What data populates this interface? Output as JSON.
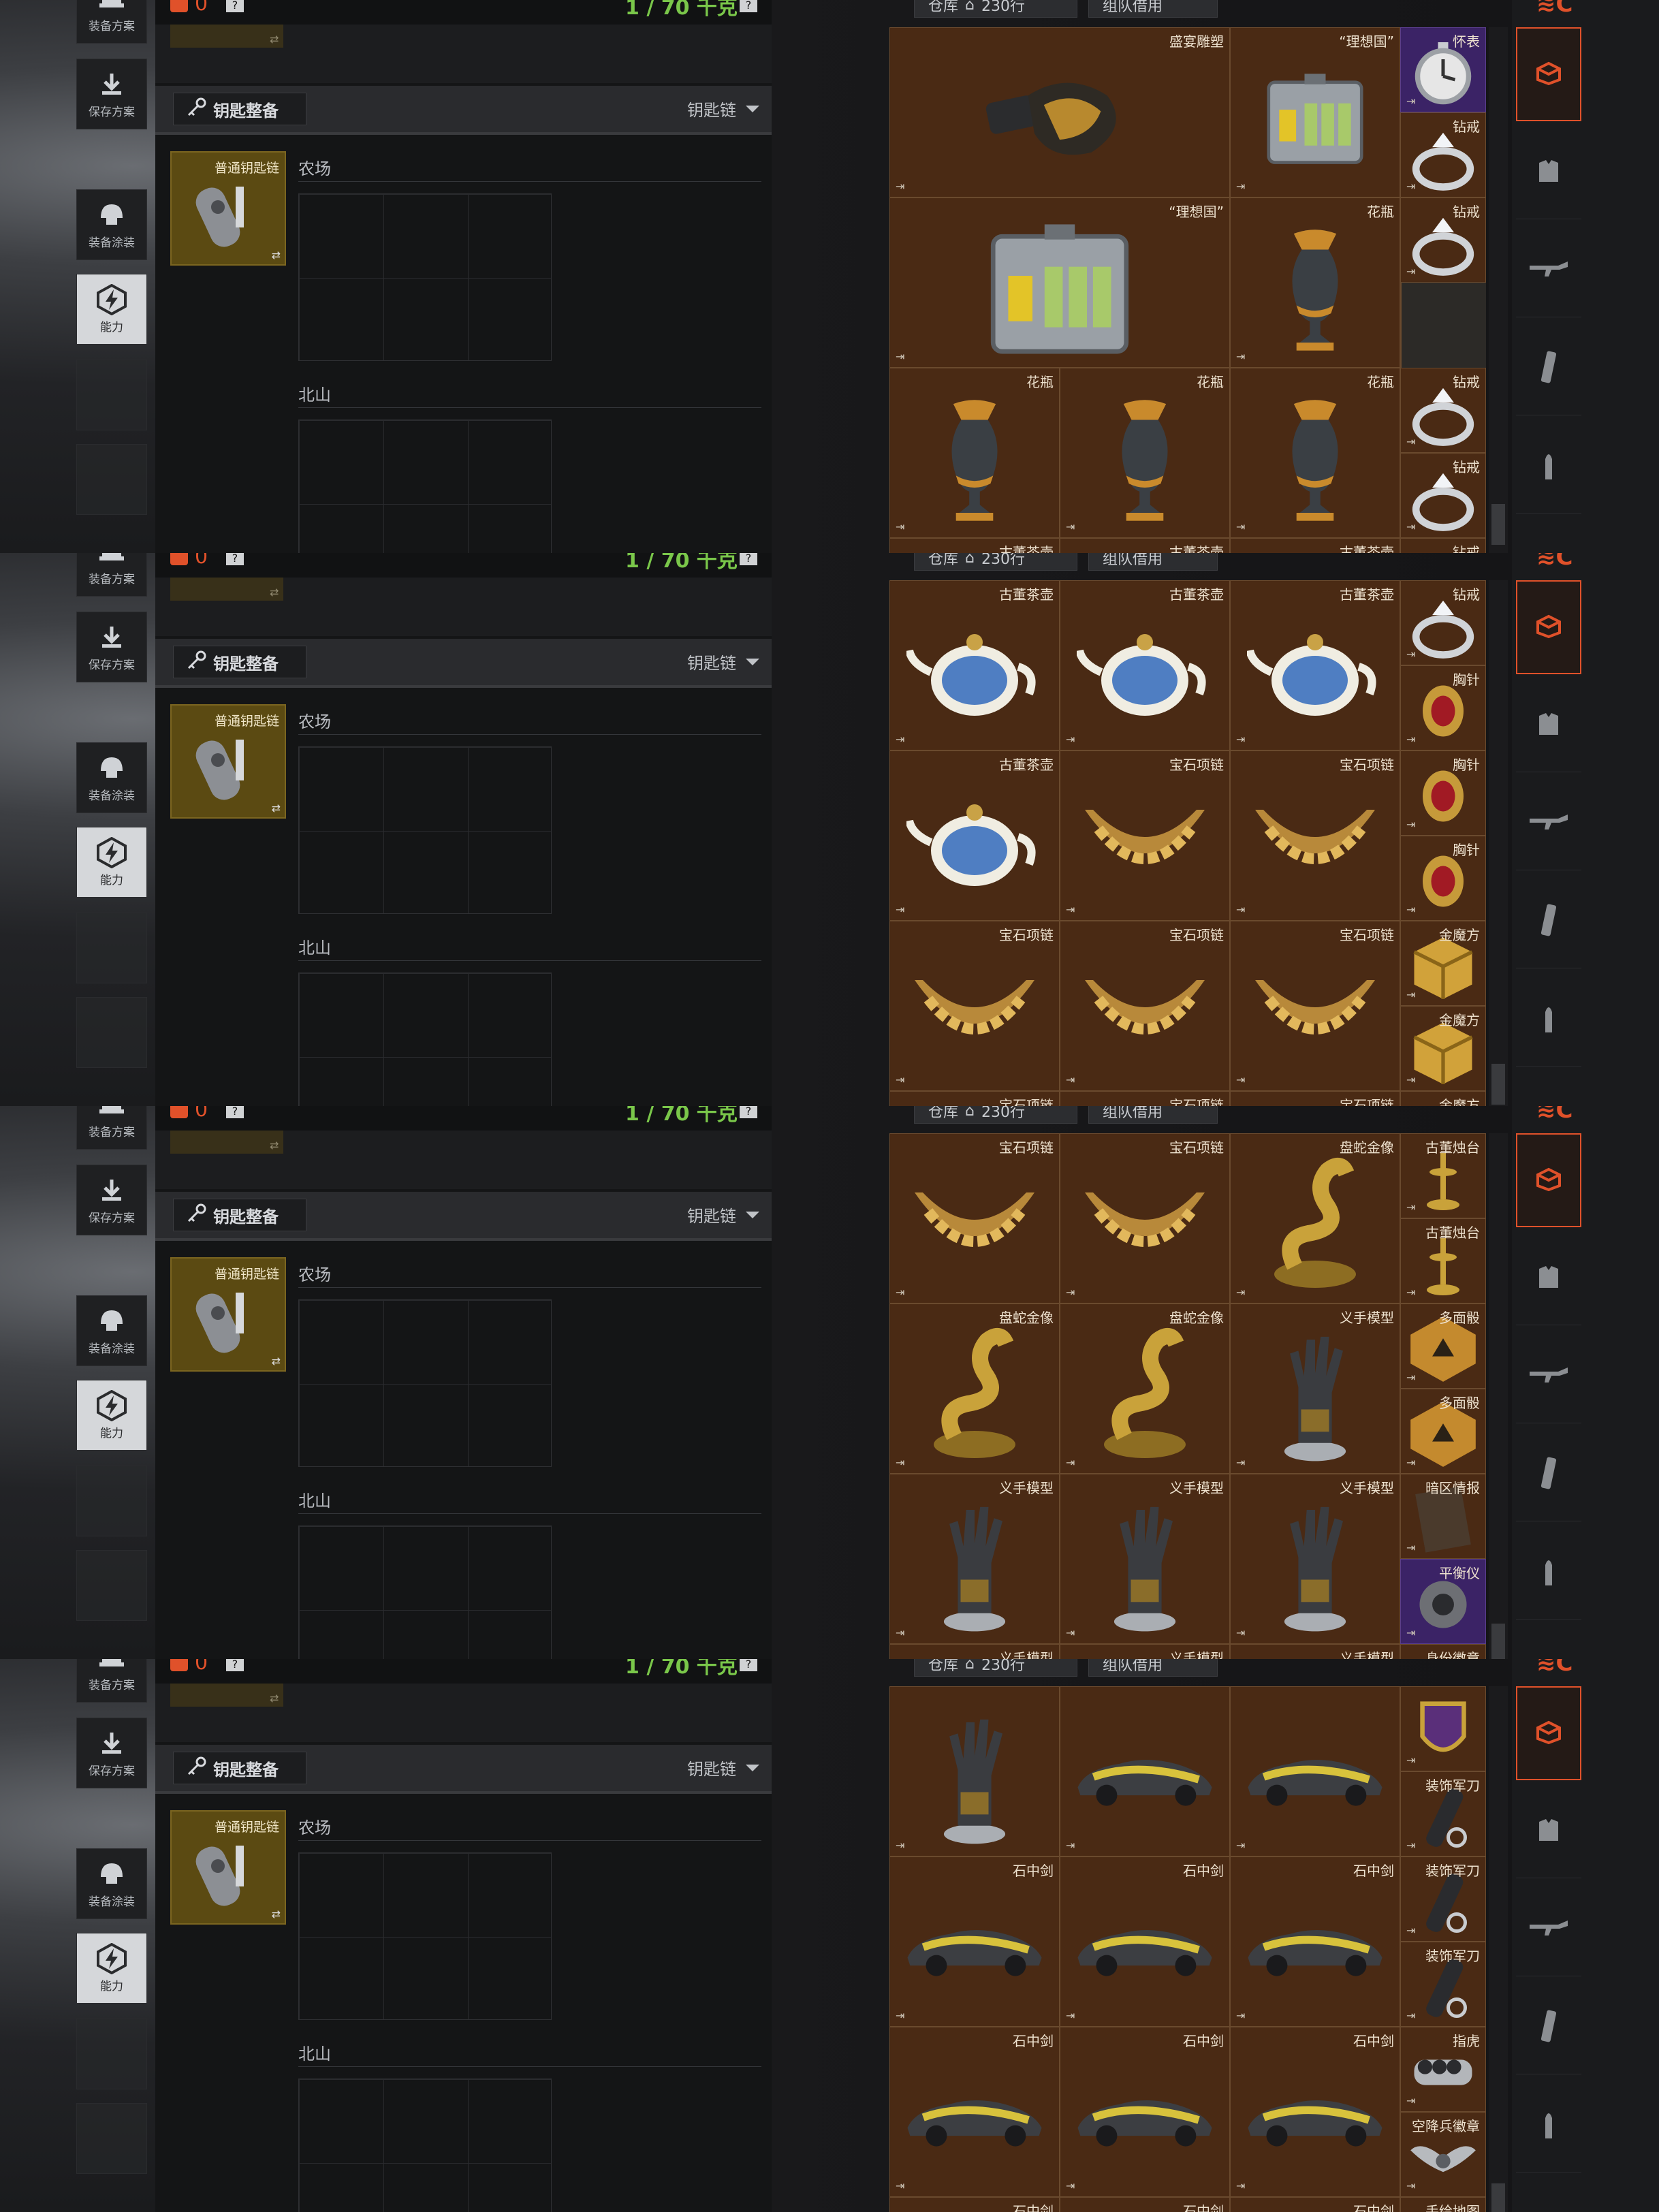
{
  "toolbar": {
    "plan": "装备方案",
    "save": "保存方案",
    "paint": "装备涂装",
    "ability": "能力"
  },
  "loadout": {
    "count": "0",
    "weight": "1 / 70 千克",
    "help": "?",
    "swap": "⇄",
    "keychain_button": "钥匙整备",
    "keychain_selector": "钥匙链",
    "keychain_item": "普通钥匙链",
    "section1": "农场",
    "section2": "北山"
  },
  "warehouse": {
    "tab1": "仓库",
    "tab1_count": "230行",
    "tab2": "组队借用",
    "corner": "⇥"
  },
  "rail": {
    "top": "≋C"
  },
  "colors": {
    "accent": "#e0512a",
    "weight_green": "#7ac74a",
    "cell_brown": "#4a2a14",
    "cell_purple": "#3b2366",
    "keycard_gold": "#5b4a12"
  },
  "panels": [
    {
      "cells": [
        {
          "n": "盛宴雕塑",
          "c": 0,
          "r": 0,
          "w": 2,
          "h": 2,
          "art": "statue"
        },
        {
          "n": "“理想国”",
          "c": 2,
          "r": 0,
          "w": 2,
          "h": 2,
          "art": "case"
        },
        {
          "n": "怀表",
          "c": 4,
          "r": 0,
          "w": 1,
          "h": 1,
          "art": "watch",
          "p": true
        },
        {
          "n": "钻戒",
          "c": 4,
          "r": 1,
          "w": 1,
          "h": 1,
          "art": "ring"
        },
        {
          "n": "“理想国”",
          "c": 0,
          "r": 2,
          "w": 2,
          "h": 2,
          "art": "case"
        },
        {
          "n": "花瓶",
          "c": 2,
          "r": 2,
          "w": 1,
          "h": 2,
          "art": "vase"
        },
        {
          "n": "花瓶",
          "c": 3,
          "r": 2,
          "w": 1,
          "h": 2,
          "art": "vase"
        },
        {
          "n": "钻戒",
          "c": 4,
          "r": 2,
          "w": 1,
          "h": 1,
          "art": "ring"
        },
        {
          "n": "花瓶",
          "c": 0,
          "r": 4,
          "w": 1,
          "h": 2,
          "art": "vase"
        },
        {
          "n": "花瓶",
          "c": 1,
          "r": 4,
          "w": 1,
          "h": 2,
          "art": "vase"
        },
        {
          "n": "花瓶",
          "c": 2,
          "r": 4,
          "w": 1,
          "h": 2,
          "art": "vase"
        },
        {
          "n": "钻戒",
          "c": 4,
          "r": 4,
          "w": 1,
          "h": 1,
          "art": "ring"
        },
        {
          "n": "钻戒",
          "c": 4,
          "r": 5,
          "w": 1,
          "h": 1,
          "art": "ring"
        },
        {
          "n": "古董茶壶",
          "c": 0,
          "r": 6,
          "w": 1,
          "h": 1,
          "art": "none"
        },
        {
          "n": "古董茶壶",
          "c": 1,
          "r": 6,
          "w": 1,
          "h": 1,
          "art": "none"
        },
        {
          "n": "古董茶壶",
          "c": 2,
          "r": 6,
          "w": 1,
          "h": 1,
          "art": "none"
        },
        {
          "n": "钻戒",
          "c": 4,
          "r": 6,
          "w": 1,
          "h": 1,
          "art": "none"
        }
      ]
    },
    {
      "cells": [
        {
          "n": "古董茶壶",
          "c": 0,
          "r": 0,
          "w": 1,
          "h": 2,
          "art": "teapot"
        },
        {
          "n": "古董茶壶",
          "c": 1,
          "r": 0,
          "w": 1,
          "h": 2,
          "art": "teapot"
        },
        {
          "n": "古董茶壶",
          "c": 2,
          "r": 0,
          "w": 1,
          "h": 2,
          "art": "teapot"
        },
        {
          "n": "钻戒",
          "c": 4,
          "r": 0,
          "w": 1,
          "h": 1,
          "art": "ring"
        },
        {
          "n": "胸针",
          "c": 4,
          "r": 1,
          "w": 1,
          "h": 1,
          "art": "brooch"
        },
        {
          "n": "古董茶壶",
          "c": 0,
          "r": 2,
          "w": 1,
          "h": 2,
          "art": "teapot"
        },
        {
          "n": "宝石项链",
          "c": 1,
          "r": 2,
          "w": 1,
          "h": 2,
          "art": "necklace"
        },
        {
          "n": "宝石项链",
          "c": 2,
          "r": 2,
          "w": 1,
          "h": 2,
          "art": "necklace"
        },
        {
          "n": "胸针",
          "c": 4,
          "r": 2,
          "w": 1,
          "h": 1,
          "art": "brooch"
        },
        {
          "n": "胸针",
          "c": 4,
          "r": 3,
          "w": 1,
          "h": 1,
          "art": "brooch"
        },
        {
          "n": "宝石项链",
          "c": 0,
          "r": 4,
          "w": 1,
          "h": 2,
          "art": "necklace"
        },
        {
          "n": "宝石项链",
          "c": 1,
          "r": 4,
          "w": 1,
          "h": 2,
          "art": "necklace"
        },
        {
          "n": "宝石项链",
          "c": 2,
          "r": 4,
          "w": 1,
          "h": 2,
          "art": "necklace"
        },
        {
          "n": "金魔方",
          "c": 4,
          "r": 4,
          "w": 1,
          "h": 1,
          "art": "cube"
        },
        {
          "n": "金魔方",
          "c": 4,
          "r": 5,
          "w": 1,
          "h": 1,
          "art": "cube"
        },
        {
          "n": "宝石项链",
          "c": 0,
          "r": 6,
          "w": 1,
          "h": 1,
          "art": "none"
        },
        {
          "n": "宝石项链",
          "c": 1,
          "r": 6,
          "w": 1,
          "h": 1,
          "art": "none"
        },
        {
          "n": "宝石项链",
          "c": 2,
          "r": 6,
          "w": 1,
          "h": 1,
          "art": "none"
        },
        {
          "n": "金魔方",
          "c": 4,
          "r": 6,
          "w": 1,
          "h": 1,
          "art": "none"
        }
      ]
    },
    {
      "cells": [
        {
          "n": "宝石项链",
          "c": 0,
          "r": 0,
          "w": 1,
          "h": 2,
          "art": "necklace"
        },
        {
          "n": "宝石项链",
          "c": 1,
          "r": 0,
          "w": 1,
          "h": 2,
          "art": "necklace"
        },
        {
          "n": "盘蛇金像",
          "c": 2,
          "r": 0,
          "w": 1,
          "h": 2,
          "art": "snake"
        },
        {
          "n": "古董烛台",
          "c": 4,
          "r": 0,
          "w": 1,
          "h": 1,
          "art": "candle"
        },
        {
          "n": "古董烛台",
          "c": 4,
          "r": 1,
          "w": 1,
          "h": 1,
          "art": "candle"
        },
        {
          "n": "盘蛇金像",
          "c": 0,
          "r": 2,
          "w": 1,
          "h": 2,
          "art": "snake"
        },
        {
          "n": "盘蛇金像",
          "c": 1,
          "r": 2,
          "w": 1,
          "h": 2,
          "art": "snake"
        },
        {
          "n": "义手模型",
          "c": 2,
          "r": 2,
          "w": 1,
          "h": 2,
          "art": "hand"
        },
        {
          "n": "多面骰",
          "c": 4,
          "r": 2,
          "w": 1,
          "h": 1,
          "art": "dice"
        },
        {
          "n": "多面骰",
          "c": 4,
          "r": 3,
          "w": 1,
          "h": 1,
          "art": "dice"
        },
        {
          "n": "义手模型",
          "c": 0,
          "r": 4,
          "w": 1,
          "h": 2,
          "art": "hand"
        },
        {
          "n": "义手模型",
          "c": 1,
          "r": 4,
          "w": 1,
          "h": 2,
          "art": "hand"
        },
        {
          "n": "义手模型",
          "c": 2,
          "r": 4,
          "w": 1,
          "h": 2,
          "art": "hand"
        },
        {
          "n": "暗区情报",
          "c": 4,
          "r": 4,
          "w": 1,
          "h": 1,
          "art": "book"
        },
        {
          "n": "平衡仪",
          "c": 4,
          "r": 5,
          "w": 1,
          "h": 1,
          "art": "gear",
          "p": true
        },
        {
          "n": "义手模型",
          "c": 0,
          "r": 6,
          "w": 1,
          "h": 1,
          "art": "none"
        },
        {
          "n": "义手模型",
          "c": 1,
          "r": 6,
          "w": 1,
          "h": 1,
          "art": "none"
        },
        {
          "n": "义手模型",
          "c": 2,
          "r": 6,
          "w": 1,
          "h": 1,
          "art": "none"
        },
        {
          "n": "身份徽章",
          "c": 4,
          "r": 6,
          "w": 1,
          "h": 1,
          "art": "none"
        }
      ]
    },
    {
      "cells": [
        {
          "n": "",
          "c": 0,
          "r": 0,
          "w": 1,
          "h": 2,
          "art": "hand"
        },
        {
          "n": "",
          "c": 1,
          "r": 0,
          "w": 1,
          "h": 2,
          "art": "car"
        },
        {
          "n": "",
          "c": 2,
          "r": 0,
          "w": 1,
          "h": 2,
          "art": "car"
        },
        {
          "n": "",
          "c": 4,
          "r": 0,
          "w": 1,
          "h": 1,
          "art": "badge"
        },
        {
          "n": "装饰军刀",
          "c": 4,
          "r": 1,
          "w": 1,
          "h": 1,
          "art": "knife"
        },
        {
          "n": "石中剑",
          "c": 0,
          "r": 2,
          "w": 1,
          "h": 2,
          "art": "car"
        },
        {
          "n": "石中剑",
          "c": 1,
          "r": 2,
          "w": 1,
          "h": 2,
          "art": "car"
        },
        {
          "n": "石中剑",
          "c": 2,
          "r": 2,
          "w": 1,
          "h": 2,
          "art": "car"
        },
        {
          "n": "装饰军刀",
          "c": 4,
          "r": 2,
          "w": 1,
          "h": 1,
          "art": "knife"
        },
        {
          "n": "装饰军刀",
          "c": 4,
          "r": 3,
          "w": 1,
          "h": 1,
          "art": "knife"
        },
        {
          "n": "石中剑",
          "c": 0,
          "r": 4,
          "w": 1,
          "h": 2,
          "art": "car"
        },
        {
          "n": "石中剑",
          "c": 1,
          "r": 4,
          "w": 1,
          "h": 2,
          "art": "car"
        },
        {
          "n": "石中剑",
          "c": 2,
          "r": 4,
          "w": 1,
          "h": 2,
          "art": "car"
        },
        {
          "n": "指虎",
          "c": 4,
          "r": 4,
          "w": 1,
          "h": 1,
          "art": "knuckle"
        },
        {
          "n": "空降兵徽章",
          "c": 4,
          "r": 5,
          "w": 1,
          "h": 1,
          "art": "wings"
        },
        {
          "n": "石中剑",
          "c": 0,
          "r": 6,
          "w": 1,
          "h": 1,
          "art": "none"
        },
        {
          "n": "石中剑",
          "c": 1,
          "r": 6,
          "w": 1,
          "h": 1,
          "art": "none"
        },
        {
          "n": "石中剑",
          "c": 2,
          "r": 6,
          "w": 1,
          "h": 1,
          "art": "none"
        },
        {
          "n": "手绘地图",
          "c": 4,
          "r": 6,
          "w": 1,
          "h": 1,
          "art": "none"
        }
      ]
    }
  ]
}
